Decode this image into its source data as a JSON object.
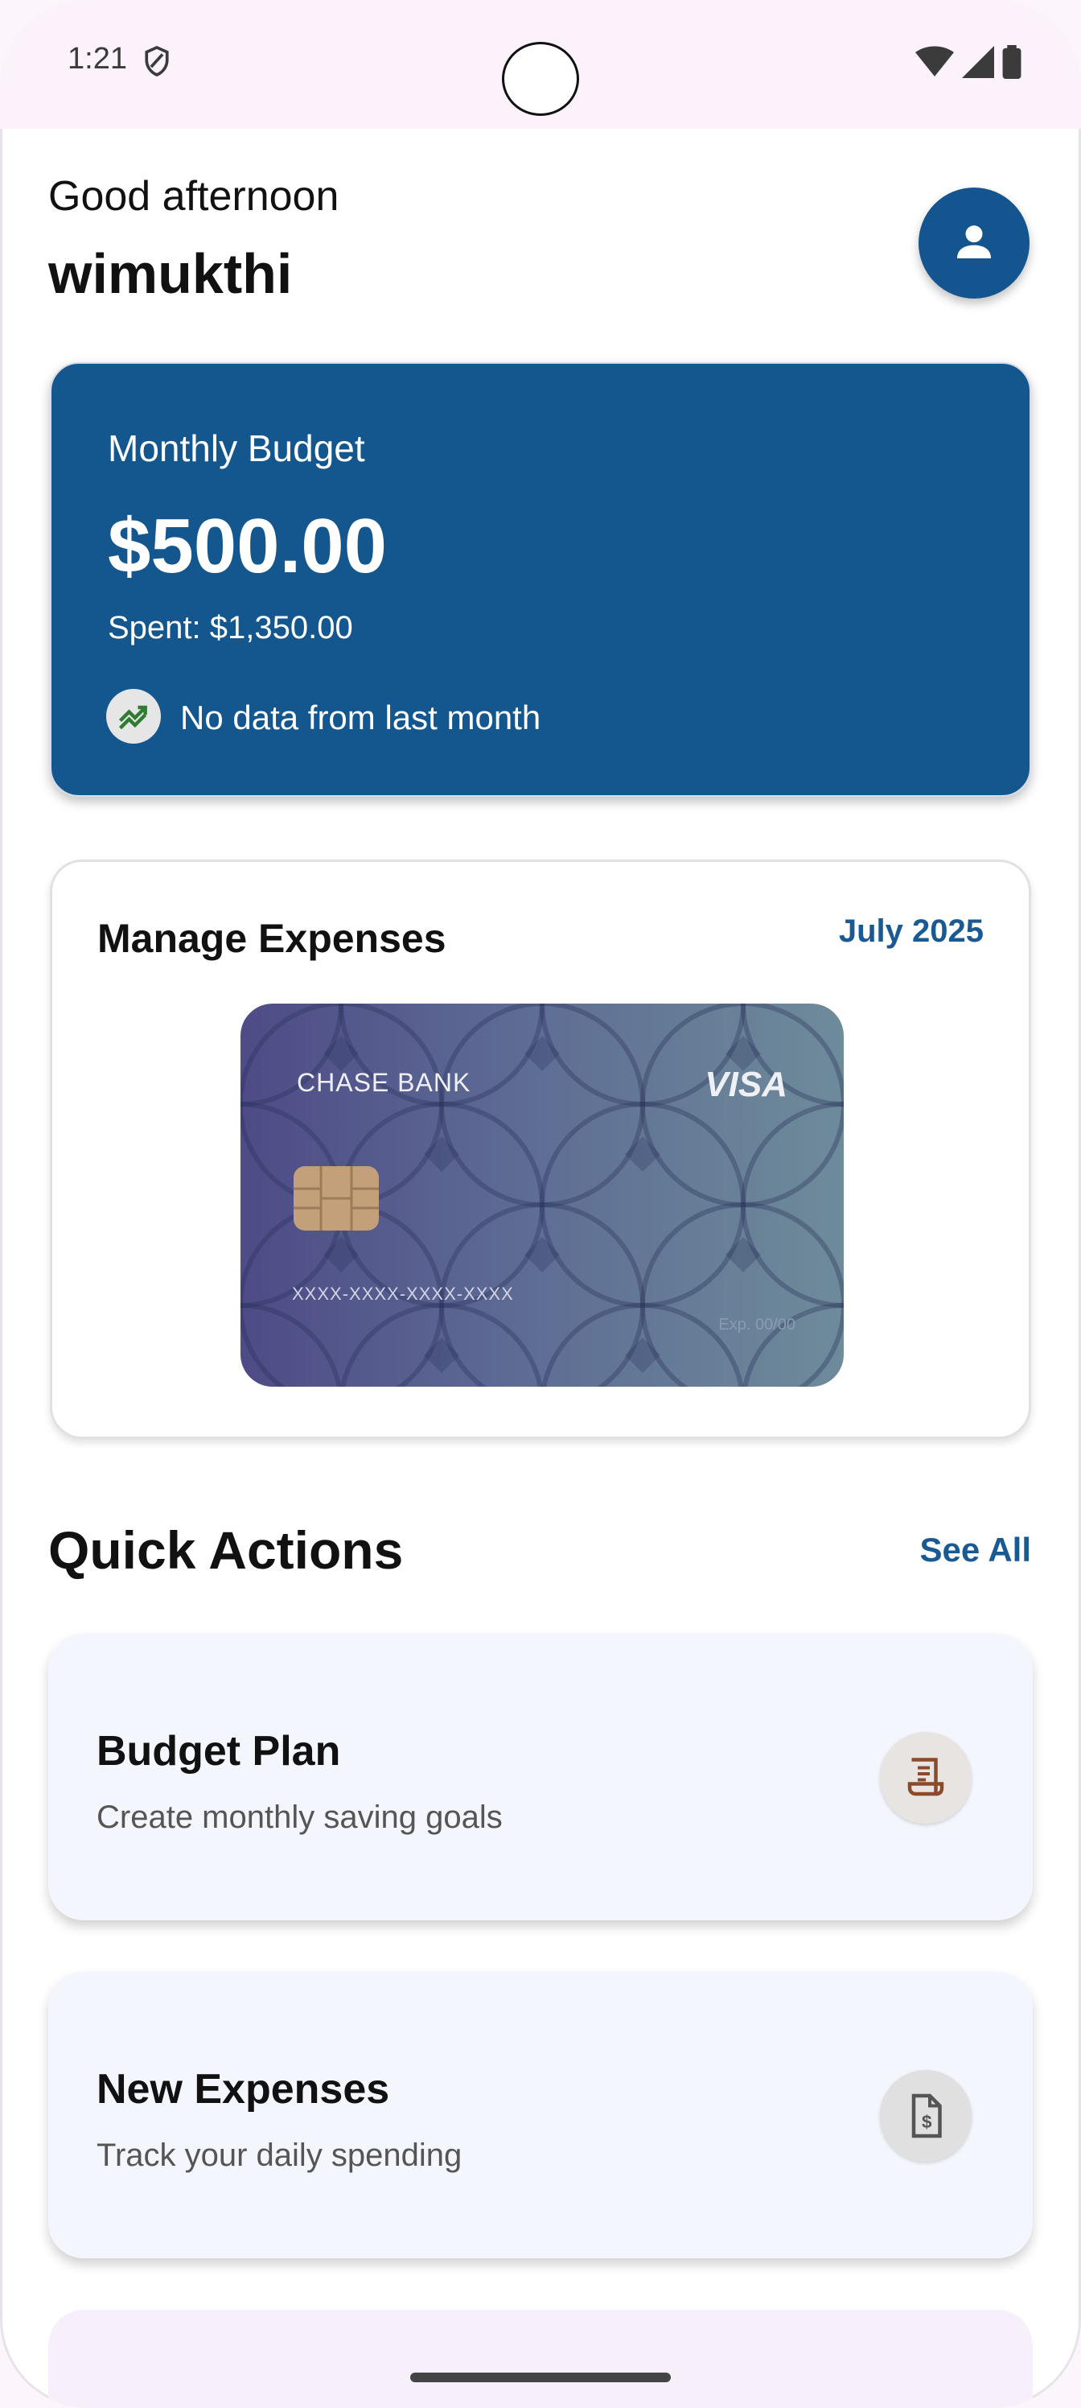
{
  "status_bar": {
    "time": "1:21"
  },
  "header": {
    "greeting": "Good afternoon",
    "username": "wimukthi"
  },
  "budget": {
    "title": "Monthly Budget",
    "amount": "$500.00",
    "spent": "Spent: $1,350.00",
    "trend_text": "No data from last month"
  },
  "manage": {
    "title": "Manage Expenses",
    "month": "July 2025",
    "card": {
      "bank": "CHASE BANK",
      "network": "VISA",
      "number": "XXXX-XXXX-XXXX-XXXX",
      "expiry": "Exp. 00/00"
    }
  },
  "quick_actions": {
    "title": "Quick Actions",
    "see_all": "See All",
    "items": [
      {
        "title": "Budget Plan",
        "subtitle": "Create monthly saving goals",
        "icon": "receipt-icon"
      },
      {
        "title": "New Expenses",
        "subtitle": "Track your daily spending",
        "icon": "dollar-document-icon"
      }
    ]
  },
  "colors": {
    "primary": "#14578f",
    "accent_text": "#1a5a93",
    "action_card_bg": "#f4f6fd",
    "status_bar_bg": "#fbf2fb"
  }
}
